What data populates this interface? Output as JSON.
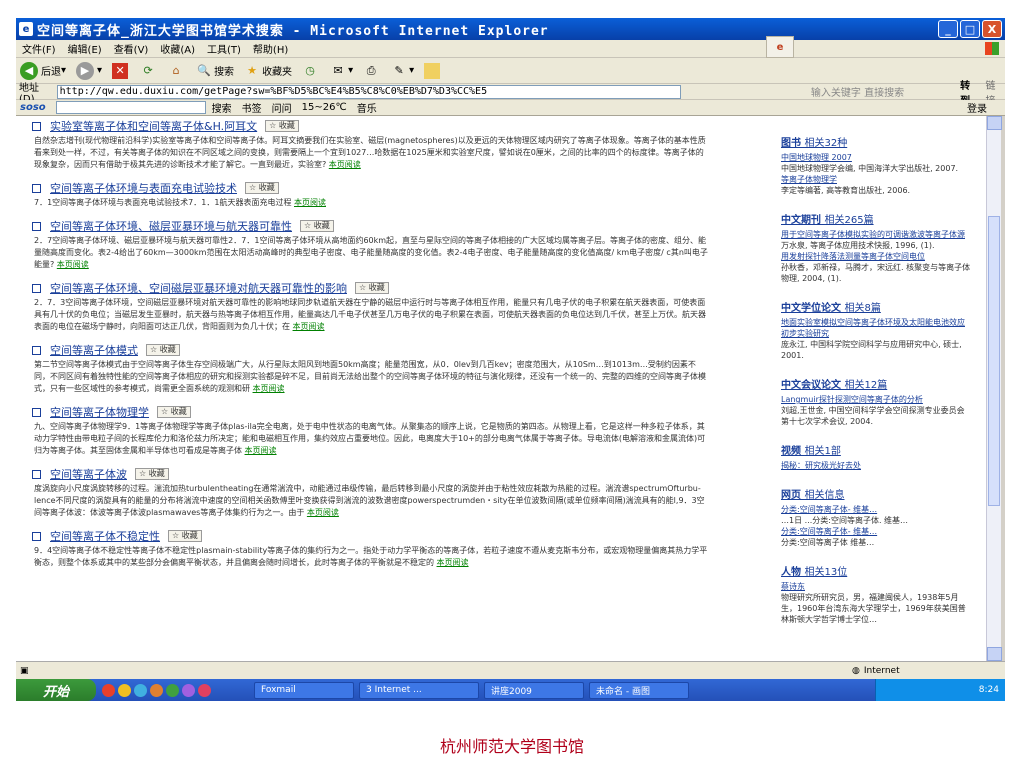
{
  "window": {
    "title": "空间等离子体_浙江大学图书馆学术搜索 - Microsoft Internet Explorer",
    "min": "_",
    "max": "□",
    "close": "X"
  },
  "menu": [
    "文件(F)",
    "编辑(E)",
    "查看(V)",
    "收藏(A)",
    "工具(T)",
    "帮助(H)"
  ],
  "toolbar": {
    "back": "后退",
    "search": "搜索",
    "favorites": "收藏夹"
  },
  "address": {
    "label": "地址(D)",
    "url": "http://qw.edu.duxiu.com/getPage?sw=%BF%D5%BC%E4%B5%C8%C0%EB%D7%D3%CC%E5",
    "hint": "输入关键字 直接搜索",
    "go": "转到",
    "links": "链接"
  },
  "soso": {
    "logo": "soso",
    "search_btn": "搜索",
    "bookmarks": "书签",
    "weather": "15~26℃",
    "music": "音乐",
    "login": "登录",
    "ask": "问问"
  },
  "results": [
    {
      "title": "实验室等离子体和空间等离子体&H.阿耳文",
      "snippet": "自然杂志增刊(现代物理前沿科学)实验室等离子体和空间等离子体。阿耳文摘要我们在实验室、磁层(magnetospheres)以及更远的天体物理区域内研究了等离子体现象。等离子体的基本性质看来到处一样，不过，有关等离子体的知识在不同区域之间的变换，则需要隔上一个宜到1027…哈数据在1025厘米和实验室尺度，譬如说在0厘米，之间的比率的四个的标度律。等离子体的现象复杂，因而只有借助于极其先进的诊断技术才能了解它。一直到最近，实验室?",
      "more": "本页阅读"
    },
    {
      "title": "空间等离子体环境与表面充电试验技术",
      "snippet": "7．1空间等离子体环境与表面充电试验技术7．1．1航天器表面充电过程",
      "more": "本页阅读"
    },
    {
      "title": "空间等离子体环境、磁层亚暴环境与航天器可靠性",
      "snippet": "2．7空间等离子体环境、磁层亚暴环境与航天器可靠性2．7．1空间等离子体环境从高地面约60km起，直至与星际空间的等离子体相接的广大区域均属等离子层。等离子体的密度、组分、能量随高度而变化。表2-4给出了60km—3000km范围在太阳活动高峰时的典型电子密度、电子能量随高度的变化值。表2-4电子密度、电子能量随高度的变化值高度/ km电子密度/ c其n叫电子能量?",
      "more": "本页阅读"
    },
    {
      "title": "空间等离子体环境、空间磁层亚暴环境对航天器可靠性的影响",
      "snippet": "2．7．3空间等离子体环境，空间磁层亚暴环境对航天器可靠性的影响地球同步轨道航天器在宁静的磁层中运行时与等离子体相互作用，能量只有几电子伏的电子积累在航天器表面，可使表面具有几十伏的负电位；当磁层发生亚暴时，航天器与热等离子体相互作用，能量高达几千电子伏甚至几万电子伏的电子积累在表面，可使航天器表面的负电位达到几千伏，甚至上万伏。航天器表面的电位在磁场宁静时，向阳面可达正几伏，背阳面则为负几十伏；在",
      "more": "本页阅读"
    },
    {
      "title": "空间等离子体模式",
      "snippet": "第二节空间等离子体模式由于空间等离子体生存空间极端广大，从行星际太阳风到地面50km高度；能量范围宽，从0．0lev到几百kev；密度范围大，从10Sm…到1013m…受制约因素不同，不同区间有着独特性能的空间等离子体相应的研究和探测实验都是碎不足，目前尚无法给出整个的空间等离子体环境的特征与演化规律，还没有一个统一的、完整的四维的空间等离子体模式，只有一些区域性的参考模式，尚需更全面系统的观测和研",
      "more": "本页阅读"
    },
    {
      "title": "空间等离子体物理学",
      "snippet": "九、空间等离子体物理学9．1等离子体物理学等离子体plas-ila完全电离，处于电中性状态的电离气体。从聚集态的顺序上说，它是物质的第四态。从物理上看，它是这样一种多粒子体系，其动力学特性由带电粒子间的长程库伦力和洛伦兹力所决定；能和电磁相互作用，集约效应占重要地位。因此，电离度大于10+的部分电离气体属于等离子体。导电流体(电解溶液和金属流体)可归为等离子体。其至固体金属和半导体也可看成是等离子体",
      "more": "本页阅读"
    },
    {
      "title": "空间等离子体波",
      "snippet": "度涡旋向小尺度涡旋转移的过程。湍流加热turbulentheating在通常湍流中，动能通过串级传输，最后转移到最小尺度的涡旋并由于粘性效应耗散为热能的过程。湍流谱spectrumOfturbu-lence不同尺度的涡旋具有的能量的分布将湍流中速度的空间相关函数傅里叶变换获得到湍流的波数谱密度powerspectrumden・sity在单位波数间隔(或单位频率间隔)湍流具有的能l,9．3空间等离子体波：体波等离子体波plasmawaves等离子体集约行为之一。由于",
      "more": "本页阅读"
    },
    {
      "title": "空间等离子体不稳定性",
      "snippet": "9．4空间等离子体不稳定性等离子体不稳定性plasmain-stability等离子体的集约行为之一。指处于动力学平衡态的等离子体，若粒子速度不遵从麦克斯韦分布，或宏观物理量偏离其热力学平衡态，则整个体系或其中的某些部分会偏离平衡状态，并且偏离会随时间增长，此时等离子体的平衡就是不稳定的",
      "more": "本页阅读"
    }
  ],
  "sidebar": {
    "books": {
      "label": "图书",
      "count": "相关32种",
      "items": [
        {
          "link": "中国地球物理 2007",
          "text": "中国地球物理学会编, 中国海洋大学出版社, 2007."
        },
        {
          "link": "等离子体物理学",
          "text": "李定等编著, 高等教育出版社, 2006."
        }
      ]
    },
    "journals": {
      "label": "中文期刊",
      "count": "相关265篇",
      "items": [
        {
          "link": "用于空间等离子体模拟实验的可调谐激波等离子体源",
          "text": "万水泉, 等离子体应用技术快报, 1996, (1)."
        },
        {
          "link": "用发射探针降落法测量等离子体空间电位",
          "text": "孙秋香，邓新禄，马腾才，宋远红. 核聚变与等离子体物理, 2004, (1)."
        }
      ]
    },
    "theses": {
      "label": "中文学位论文",
      "count": "相关8篇",
      "items": [
        {
          "link": "地面实验室模拟空间等离子体环境及太阳能电池效应初步实验研究",
          "text": "庞永江, 中国科学院空间科学与应用研究中心, 硕士, 2001."
        }
      ]
    },
    "conf": {
      "label": "中文会议论文",
      "count": "相关12篇",
      "items": [
        {
          "link": "Langmuir探针探测空间等离子体的分析",
          "text": "刘超,王世金, 中国空间科学学会空间探测专业委员会第十七次学术会议, 2004."
        }
      ]
    },
    "video": {
      "label": "视频",
      "count": "相关1部",
      "items": [
        {
          "link": "揭秘：研究极光好去处",
          "text": ""
        }
      ]
    },
    "web": {
      "label": "网页",
      "count": "相关信息",
      "items": [
        {
          "link": "分类:空间等离子体- 维基…",
          "text": "…1日 ...分类:空间等离子体. 维基…"
        },
        {
          "link": "分类:空间等离子体- 维基…",
          "text": "分类:空间等离子体 维基…"
        }
      ]
    },
    "people": {
      "label": "人物",
      "count": "相关13位",
      "items": [
        {
          "link": "蔡诗东",
          "text": "物理研究所研究员，男，福建闽侯人，1938年5月生，1960年台湾东海大学理学士，1969年获美国普林斯顿大学哲学博士学位…"
        }
      ]
    }
  },
  "status": {
    "zone": "Internet"
  },
  "taskbar": {
    "start": "开始",
    "tasks": [
      "Foxmail",
      "3 Internet ...",
      "讲座2009",
      "未命名 - 画图"
    ],
    "clock": "8:24"
  },
  "caption": "杭州师范大学图书馆"
}
